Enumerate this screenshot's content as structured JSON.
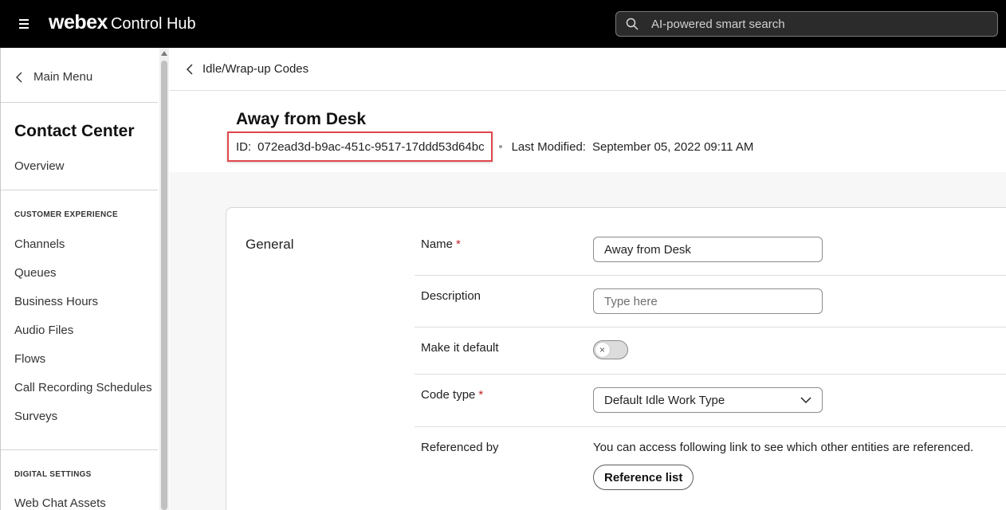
{
  "topbar": {
    "logo": "webex",
    "product": "Control Hub",
    "search_placeholder": "AI-powered smart search"
  },
  "sidebar": {
    "main_menu": "Main Menu",
    "title": "Contact Center",
    "overview": "Overview",
    "sections": [
      {
        "heading": "CUSTOMER EXPERIENCE",
        "items": [
          "Channels",
          "Queues",
          "Business Hours",
          "Audio Files",
          "Flows",
          "Call Recording Schedules",
          "Surveys"
        ]
      },
      {
        "heading": "DIGITAL SETTINGS",
        "items": [
          "Web Chat Assets"
        ]
      }
    ]
  },
  "breadcrumb": {
    "back_label": "Idle/Wrap-up Codes"
  },
  "header": {
    "title": "Away from Desk",
    "id_label": "ID:",
    "id_value": "072ead3d-b9ac-451c-9517-17ddd53d64bc",
    "modified_label": "Last Modified:",
    "modified_value": "September 05, 2022 09:11 AM"
  },
  "form": {
    "section": "General",
    "name_label": "Name",
    "required_mark": "*",
    "name_value": "Away from Desk",
    "description_label": "Description",
    "description_placeholder": "Type here",
    "default_label": "Make it default",
    "default_on": false,
    "code_type_label": "Code type",
    "code_type_value": "Default Idle Work Type",
    "referenced_label": "Referenced by",
    "referenced_text": "You can access following link to see which other entities are referenced.",
    "reference_button": "Reference list"
  },
  "colors": {
    "topbar_bg": "#000000",
    "highlight_border": "#e0474c",
    "required": "#c3232a"
  }
}
